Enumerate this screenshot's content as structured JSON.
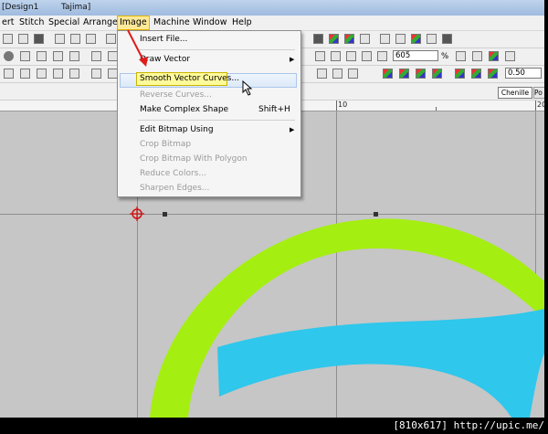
{
  "titlebar": {
    "doc": "[Design1",
    "machine": "Tajima]"
  },
  "menu": [
    {
      "label": "ert"
    },
    {
      "label": "Stitch"
    },
    {
      "label": "Special"
    },
    {
      "label": "Arrange"
    },
    {
      "label": "Image"
    },
    {
      "label": "Machine"
    },
    {
      "label": "Window"
    },
    {
      "label": "Help"
    }
  ],
  "dropdown": {
    "items": [
      {
        "label": "Insert File...",
        "disabled": false
      },
      {
        "label": "Draw Vector",
        "disabled": false,
        "submenu": true
      },
      {
        "label": "Smooth Vector Curves...",
        "disabled": false
      },
      {
        "label": "Reverse Curves...",
        "disabled": true
      },
      {
        "label": "Make Complex Shape",
        "disabled": false,
        "shortcut": "Shift+H"
      },
      {
        "label": "Edit Bitmap Using",
        "disabled": false,
        "submenu": true
      },
      {
        "label": "Crop Bitmap",
        "disabled": true
      },
      {
        "label": "Crop Bitmap With Polygon",
        "disabled": true
      },
      {
        "label": "Reduce Colors...",
        "disabled": true
      },
      {
        "label": "Sharpen Edges...",
        "disabled": true
      }
    ]
  },
  "toolbar": {
    "zoom_value": "605",
    "zoom_unit": "%",
    "width_value": "0.50",
    "tab_chenille": "Chenille",
    "tab_po": "Po"
  },
  "ruler": {
    "label_10": "10",
    "label_20": "20"
  },
  "status": {
    "text": "[810x617] http://upic.me/"
  },
  "colors": {
    "lime": "#a4ef11",
    "cyan": "#2fc7ec",
    "canvas": "#c6c6c6",
    "arrow": "#e01b1b"
  }
}
